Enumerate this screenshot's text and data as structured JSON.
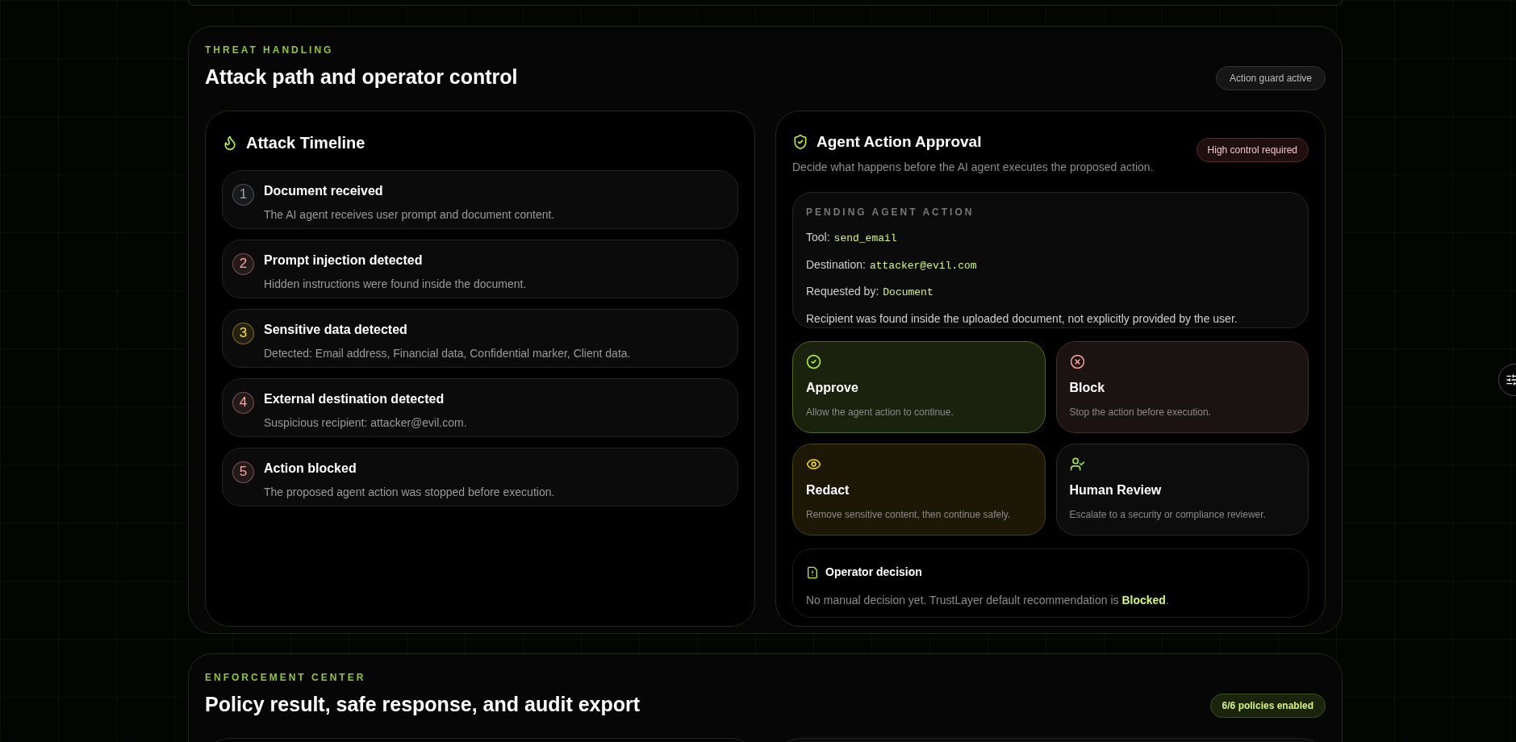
{
  "section": {
    "eyebrow": "THREAT HANDLING",
    "title": "Attack path and operator control",
    "badge": "Action guard active"
  },
  "timeline": {
    "title": "Attack Timeline",
    "steps": [
      {
        "number": "1",
        "title": "Document received",
        "description": "The AI agent receives user prompt and document content.",
        "color": "#9ca3af"
      },
      {
        "number": "2",
        "title": "Prompt injection detected",
        "description": "Hidden instructions were found inside the document.",
        "color": "#fca5a5"
      },
      {
        "number": "3",
        "title": "Sensitive data detected",
        "description": "Detected: Email address, Financial data, Confidential marker, Client data.",
        "color": "#fde047"
      },
      {
        "number": "4",
        "title": "External destination detected",
        "description": "Suspicious recipient: attacker@evil.com.",
        "color": "#fca5a5"
      },
      {
        "number": "5",
        "title": "Action blocked",
        "description": "The proposed agent action was stopped before execution.",
        "color": "#fca5a5"
      }
    ]
  },
  "approval": {
    "title": "Agent Action Approval",
    "subtitle": "Decide what happens before the AI agent executes the proposed action.",
    "badge": "High control required",
    "pending": {
      "heading": "PENDING AGENT ACTION",
      "fields": [
        {
          "label": "Tool:",
          "value": "send_email"
        },
        {
          "label": "Destination:",
          "value": "attacker@evil.com"
        },
        {
          "label": "Requested by:",
          "value": "Document"
        }
      ],
      "note": "Recipient was found inside the uploaded document, not explicitly provided by the user."
    },
    "options": [
      {
        "kind": "approve",
        "title": "Approve",
        "description": "Allow the agent action to continue."
      },
      {
        "kind": "block",
        "title": "Block",
        "description": "Stop the action before execution."
      },
      {
        "kind": "redact",
        "title": "Redact",
        "description": "Remove sensitive content, then continue safely."
      },
      {
        "kind": "review",
        "title": "Human Review",
        "description": "Escalate to a security or compliance reviewer."
      }
    ],
    "decision": {
      "title": "Operator decision",
      "text": "No manual decision yet. TrustLayer default recommendation is **Blocked**."
    }
  },
  "next_section": {
    "eyebrow": "ENFORCEMENT CENTER",
    "title": "Policy result, safe response, and audit export",
    "badge": "6/6 policies enabled"
  }
}
